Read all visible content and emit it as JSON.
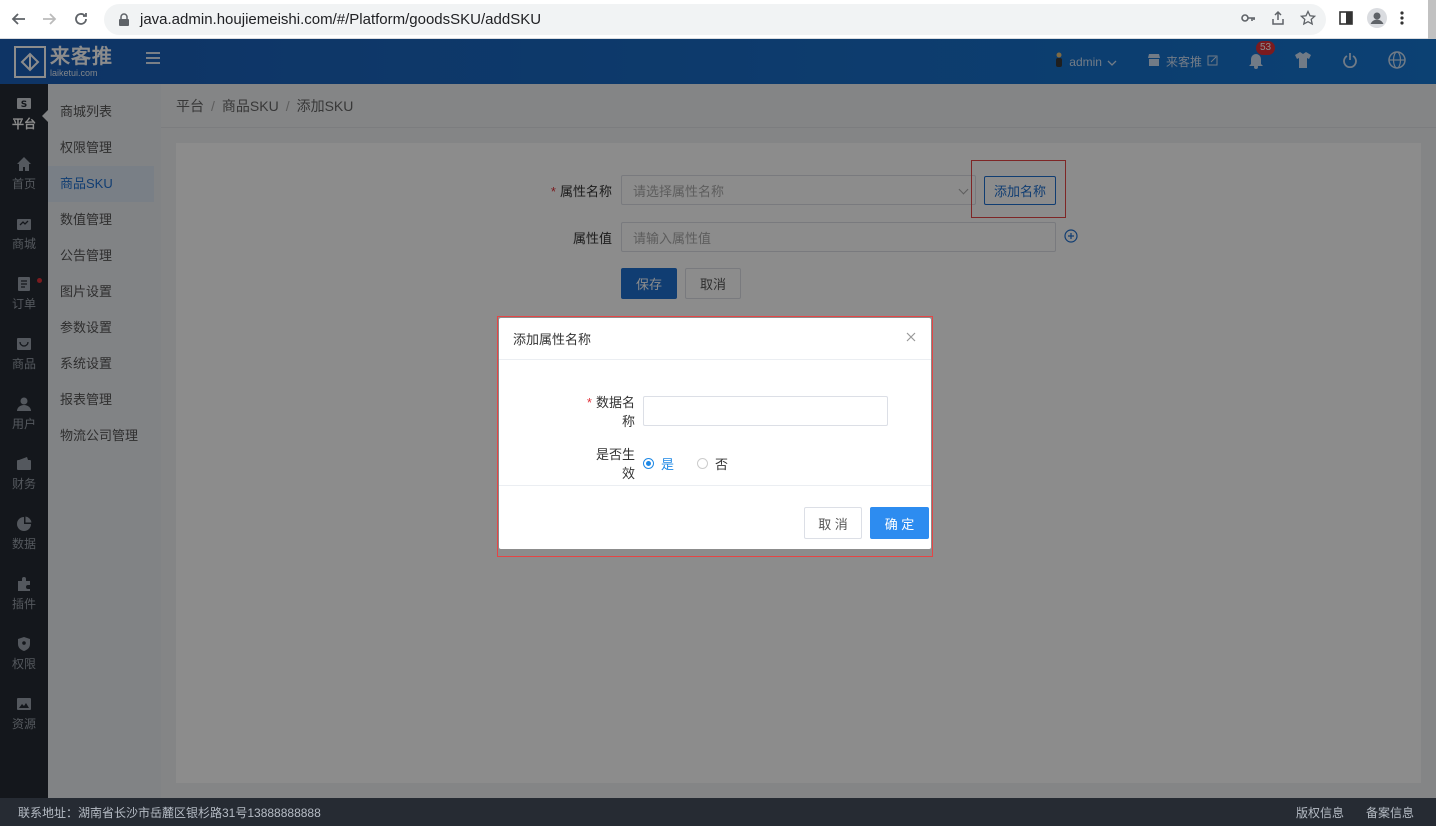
{
  "browser": {
    "url": "java.admin.houjiemeishi.com/#/Platform/goodsSKU/addSKU"
  },
  "header": {
    "logo_cn": "来客推",
    "logo_en": "laiketui.com",
    "user": "admin",
    "store": "来客推",
    "notification_count": "53",
    "accent": "#1677d2"
  },
  "left_nav": {
    "items": [
      {
        "label": "平台",
        "icon": "s-badge-icon"
      },
      {
        "label": "首页",
        "icon": "home-icon"
      },
      {
        "label": "商城",
        "icon": "store-icon"
      },
      {
        "label": "订单",
        "icon": "order-icon"
      },
      {
        "label": "商品",
        "icon": "goods-icon"
      },
      {
        "label": "用户",
        "icon": "user-icon"
      },
      {
        "label": "财务",
        "icon": "wallet-icon"
      },
      {
        "label": "数据",
        "icon": "pie-icon"
      },
      {
        "label": "插件",
        "icon": "puzzle-icon"
      },
      {
        "label": "权限",
        "icon": "shield-icon"
      },
      {
        "label": "资源",
        "icon": "image-icon"
      }
    ]
  },
  "sub_menu": {
    "items": [
      {
        "label": "商城列表"
      },
      {
        "label": "权限管理"
      },
      {
        "label": "商品SKU"
      },
      {
        "label": "数值管理"
      },
      {
        "label": "公告管理"
      },
      {
        "label": "图片设置"
      },
      {
        "label": "参数设置"
      },
      {
        "label": "系统设置"
      },
      {
        "label": "报表管理"
      },
      {
        "label": "物流公司管理"
      }
    ]
  },
  "breadcrumb": {
    "items": [
      "平台",
      "商品SKU",
      "添加SKU"
    ],
    "sep": "/"
  },
  "form": {
    "attr_name_label": "属性名称",
    "attr_name_placeholder": "请选择属性名称",
    "add_name_button": "添加名称",
    "attr_value_label": "属性值",
    "attr_value_placeholder": "请输入属性值",
    "save_button": "保存",
    "cancel_button": "取消"
  },
  "dialog": {
    "title": "添加属性名称",
    "data_name_label": "数据名称",
    "data_name_value": "",
    "effective_label": "是否生效",
    "option_yes": "是",
    "option_no": "否",
    "selected": "是",
    "cancel_button": "取 消",
    "confirm_button": "确 定"
  },
  "footer": {
    "address": "联系地址：湖南省长沙市岳麓区银杉路31号13888888888",
    "copyright": "版权信息",
    "record": "备案信息"
  }
}
